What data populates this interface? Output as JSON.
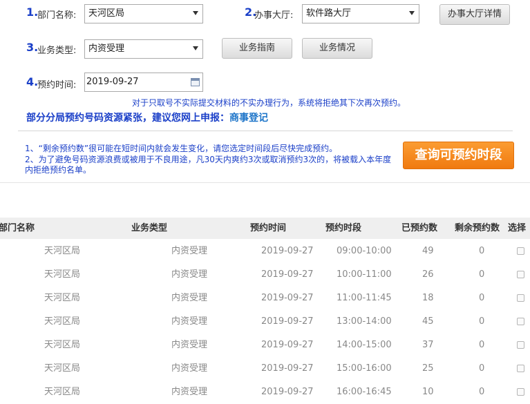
{
  "form": {
    "dept": {
      "num": "1.",
      "label": "部门名称:",
      "value": "天河区局"
    },
    "hall": {
      "num": "2.",
      "label": "办事大厅:",
      "value": "软件路大厅",
      "detail_button": "办事大厅详情"
    },
    "biz": {
      "num": "3.",
      "label": "业务类型:",
      "value": "内资受理",
      "guide_button": "业务指南",
      "status_button": "业务情况"
    },
    "time": {
      "num": "4.",
      "label": "预约时间:",
      "value": "2019-09-27"
    }
  },
  "notice": "对于只取号不实际提交材料的不实办理行为，系统将拒绝其下次再次预约。",
  "warning": {
    "text": "部分分局预约号码资源紧张，建议您网上申报：",
    "link": "商事登记"
  },
  "hints": [
    "1、“剩余预约数”很可能在短时间内就会发生变化，请您选定时间段后尽快完成预约。",
    "2、为了避免号码资源浪费或被用于不良用途，凡30天内爽约3次或取消预约3次的，将被载入本年度内拒绝预约名单。"
  ],
  "query_button": "查询可预约时段",
  "table": {
    "headers": [
      "部门名称",
      "业务类型",
      "预约时间",
      "预约时段",
      "已预约数",
      "剩余预约数",
      "选择"
    ],
    "rows": [
      [
        "天河区局",
        "内资受理",
        "2019-09-27",
        "09:00-10:00",
        "49",
        "0"
      ],
      [
        "天河区局",
        "内资受理",
        "2019-09-27",
        "10:00-11:00",
        "26",
        "0"
      ],
      [
        "天河区局",
        "内资受理",
        "2019-09-27",
        "11:00-11:45",
        "18",
        "0"
      ],
      [
        "天河区局",
        "内资受理",
        "2019-09-27",
        "13:00-14:00",
        "45",
        "0"
      ],
      [
        "天河区局",
        "内资受理",
        "2019-09-27",
        "14:00-15:00",
        "37",
        "0"
      ],
      [
        "天河区局",
        "内资受理",
        "2019-09-27",
        "15:00-16:00",
        "25",
        "0"
      ],
      [
        "天河区局",
        "内资受理",
        "2019-09-27",
        "16:00-16:45",
        "10",
        "0"
      ]
    ]
  }
}
